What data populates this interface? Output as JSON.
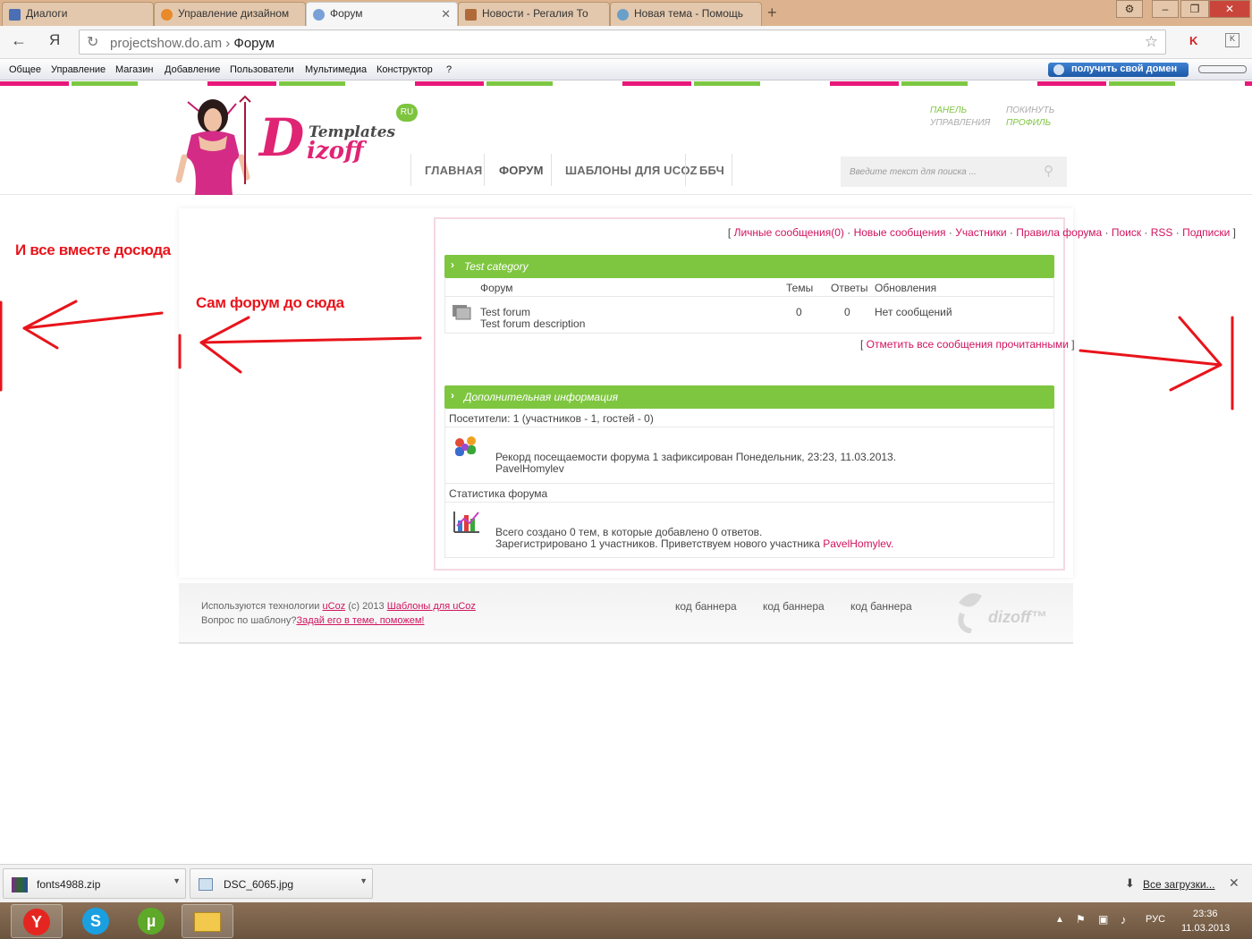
{
  "browser": {
    "tabs": [
      {
        "label": "Диалоги",
        "active": false
      },
      {
        "label": "Управление дизайном",
        "active": false
      },
      {
        "label": "Форум",
        "active": true
      },
      {
        "label": "Новости - Регалия То",
        "active": false
      },
      {
        "label": "Новая тема - Помощь",
        "active": false
      }
    ],
    "address": {
      "host": "projectshow.do.am",
      "separator": "›",
      "page": "Форум"
    }
  },
  "ucoz_panel": {
    "menu": [
      "Общее",
      "Управление",
      "Магазин",
      "Добавление",
      "Пользователи",
      "Мультимедиа",
      "Конструктор",
      "?"
    ],
    "domain_button": "получить свой домен"
  },
  "site": {
    "logo": {
      "ru": "RU",
      "templates": "Templates",
      "d": "D",
      "izoff": "izoff"
    },
    "nav": [
      "ГЛАВНАЯ",
      "ФОРУМ",
      "ШАБЛОНЫ ДЛЯ UCOZ",
      "ББЧ"
    ],
    "search_placeholder": "Введите текст для поиска ...",
    "panel_link": [
      "ПАНЕЛЬ",
      "УПРАВЛЕНИЯ"
    ],
    "user_links": [
      "ПОКИНУТЬ",
      "ПРОФИЛЬ"
    ]
  },
  "forum": {
    "top_links": [
      "Личные сообщения(0)",
      "Новые сообщения",
      "Участники",
      "Правила форума",
      "Поиск",
      "RSS",
      "Подписки"
    ],
    "category": "Test category",
    "columns": {
      "forum": "Форум",
      "topics": "Темы",
      "replies": "Ответы",
      "updates": "Обновления"
    },
    "forums": [
      {
        "name": "Test forum",
        "description": "Test forum description",
        "topics": "0",
        "replies": "0",
        "updates": "Нет сообщений"
      }
    ],
    "mark_read": "Отметить все сообщения прочитанными",
    "info_title": "Дополнительная информация",
    "visitors": "Посетители: 1  (участников - 1, гостей - 0)",
    "record": "Рекорд посещаемости форума 1 зафиксирован Понедельник, 23:23, 11.03.2013.",
    "record_user": "PavelHomylev",
    "stats_title": "Статистика форума",
    "stats_line1": "Всего создано 0 тем, в которые добавлено 0 ответов.",
    "stats_line2": "Зарегистрировано 1 участников. Приветствуем нового участника",
    "stats_user": "PavelHomylev",
    "stats_end": "."
  },
  "footer": {
    "line1_pre": "Используются технологии",
    "ucoz": "uCoz",
    "line1_mid": "(c) 2013",
    "templates_link": "Шаблоны для uCoz",
    "line2_pre": "Вопрос по шаблону?",
    "ask_link": "Задай его в теме, поможем!",
    "banners": [
      "код баннера",
      "код баннера",
      "код баннера"
    ],
    "brand": "dizoff™"
  },
  "annotations": {
    "all_together": "И все вместе досюда",
    "forum_itself": "Сам форум до сюда"
  },
  "downloads": {
    "items": [
      "fonts4988.zip",
      "DSC_6065.jpg"
    ],
    "all": "Все загрузки..."
  },
  "taskbar": {
    "lang": "РУС",
    "time": "23:36",
    "date": "11.03.2013"
  },
  "colors": {
    "accent_pink": "#d0135e",
    "accent_green": "#7ec63f",
    "annotation_red": "#e8141b"
  }
}
